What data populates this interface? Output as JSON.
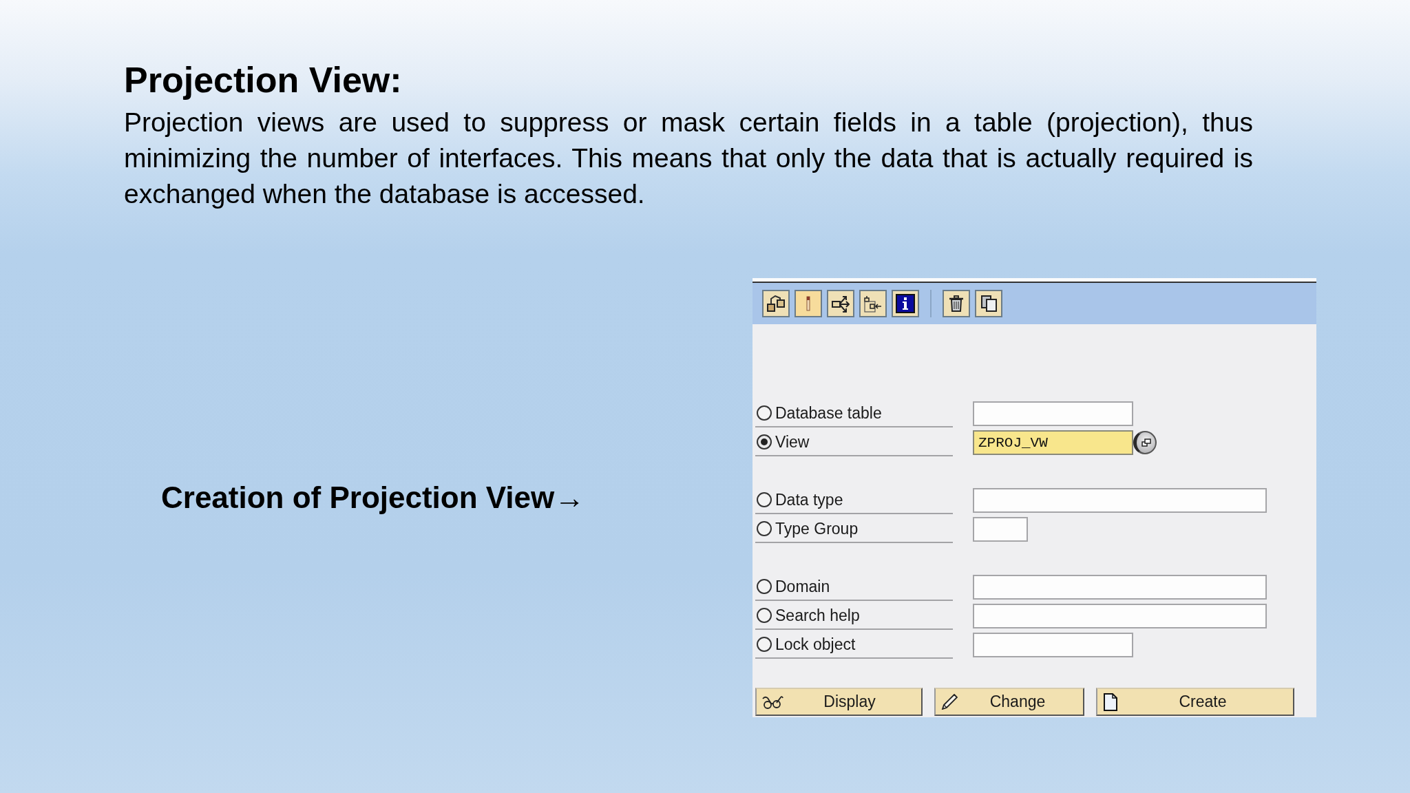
{
  "slide": {
    "title": "Projection View:",
    "body": "Projection views are used to suppress or mask certain fields in a table (projection), thus minimizing the number of interfaces. This means that only the data that is actually required is exchanged when the database is accessed."
  },
  "caption": "Creation of Projection View→",
  "dictionary_screen": {
    "groups": [
      {
        "options": [
          {
            "label": "Database table",
            "selected": false
          },
          {
            "label": "View",
            "selected": true,
            "value": "ZPROJ_VW"
          }
        ]
      },
      {
        "options": [
          {
            "label": "Data type",
            "selected": false
          },
          {
            "label": "Type Group",
            "selected": false
          }
        ]
      },
      {
        "options": [
          {
            "label": "Domain",
            "selected": false
          },
          {
            "label": "Search help",
            "selected": false
          },
          {
            "label": "Lock object",
            "selected": false
          }
        ]
      }
    ],
    "buttons": [
      {
        "label": "Display"
      },
      {
        "label": "Change"
      },
      {
        "label": "Create"
      }
    ]
  }
}
